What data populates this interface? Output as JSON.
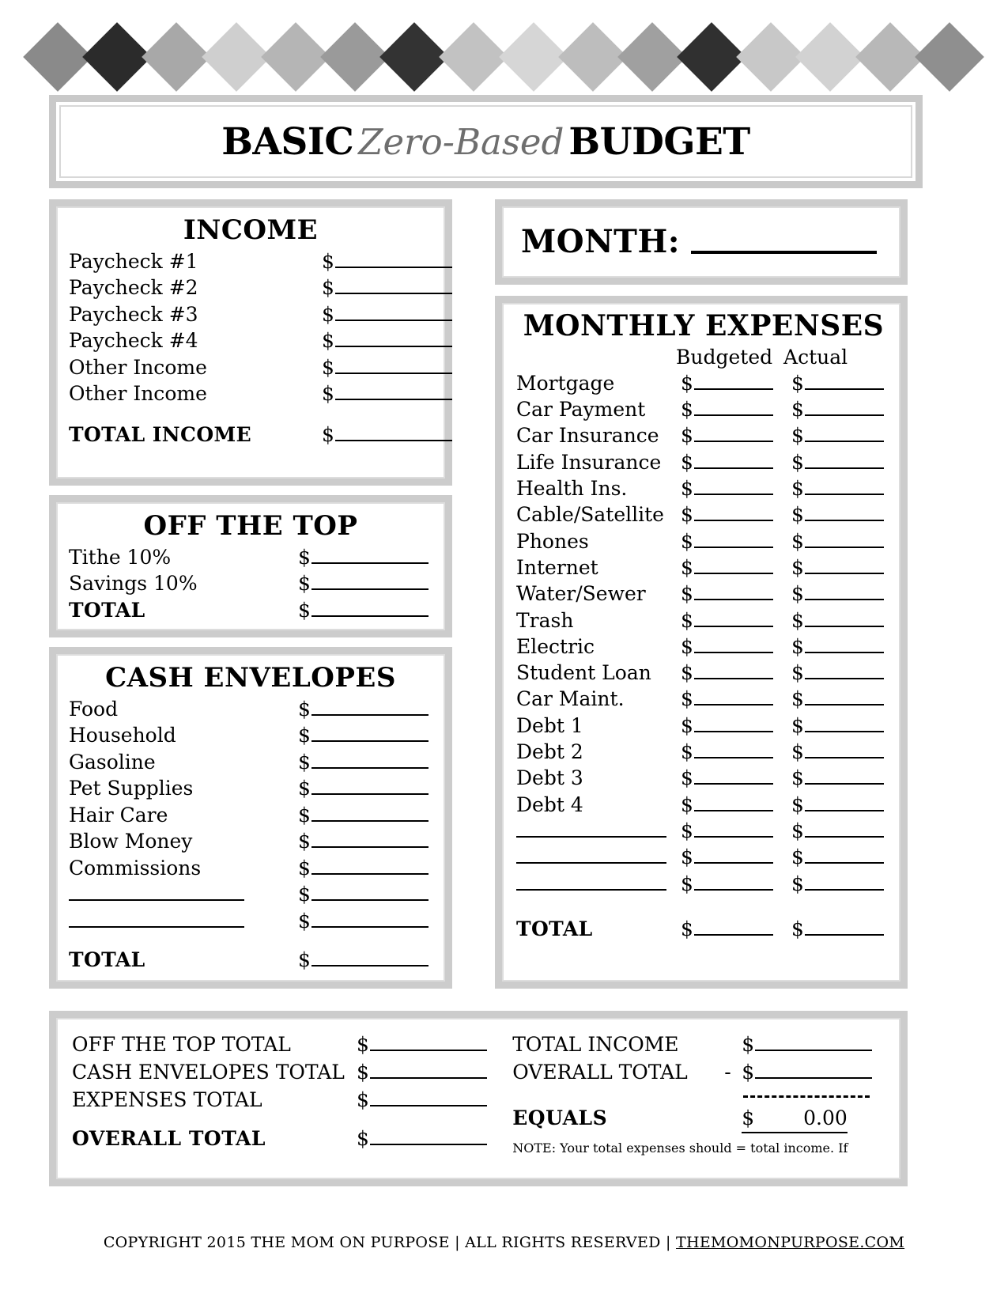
{
  "banner": {
    "diamond_colors": [
      "#8a8a8a",
      "#2b2b2b",
      "#a8a8a8",
      "#cfcfcf",
      "#b5b5b5",
      "#9a9a9a",
      "#333333",
      "#c2c2c2",
      "#d6d6d6",
      "#bdbdbd",
      "#a0a0a0",
      "#303030",
      "#c8c8c8",
      "#d2d2d2",
      "#b8b8b8",
      "#8f8f8f"
    ]
  },
  "title": {
    "part1": "BASIC",
    "part2": "Zero-Based",
    "part3": "BUDGET"
  },
  "income": {
    "heading": "INCOME",
    "rows": [
      {
        "label": "Paycheck #1",
        "dollar": "$"
      },
      {
        "label": "Paycheck #2",
        "dollar": "$"
      },
      {
        "label": "Paycheck #3",
        "dollar": "$"
      },
      {
        "label": "Paycheck #4",
        "dollar": "$"
      },
      {
        "label": "Other Income",
        "dollar": "$"
      },
      {
        "label": "Other Income",
        "dollar": "$"
      }
    ],
    "total_label": "TOTAL INCOME",
    "total_dollar": "$"
  },
  "off_the_top": {
    "heading": "OFF THE TOP",
    "rows": [
      {
        "label": "Tithe 10%",
        "dollar": "$"
      },
      {
        "label": "Savings 10%",
        "dollar": "$"
      }
    ],
    "total_label": "TOTAL",
    "total_dollar": "$"
  },
  "cash_envelopes": {
    "heading": "CASH ENVELOPES",
    "rows": [
      {
        "label": "Food",
        "dollar": "$"
      },
      {
        "label": "Household",
        "dollar": "$"
      },
      {
        "label": "Gasoline",
        "dollar": "$"
      },
      {
        "label": "Pet Supplies",
        "dollar": "$"
      },
      {
        "label": "Hair Care",
        "dollar": "$"
      },
      {
        "label": "Blow Money",
        "dollar": "$"
      },
      {
        "label": "Commissions",
        "dollar": "$"
      }
    ],
    "blank_rows": [
      {
        "label": "",
        "dollar": "$"
      },
      {
        "label": "",
        "dollar": "$"
      }
    ],
    "total_label": "TOTAL",
    "total_dollar": "$"
  },
  "month": {
    "label": "MONTH:",
    "value": ""
  },
  "expenses": {
    "heading": "MONTHLY EXPENSES",
    "col_budgeted": "Budgeted",
    "col_actual": "Actual",
    "rows": [
      {
        "label": "Mortgage",
        "budgeted": "$",
        "actual": "$"
      },
      {
        "label": "Car Payment",
        "budgeted": "$",
        "actual": "$"
      },
      {
        "label": "Car Insurance",
        "budgeted": "$",
        "actual": "$"
      },
      {
        "label": "Life Insurance",
        "budgeted": "$",
        "actual": "$"
      },
      {
        "label": "Health Ins.",
        "budgeted": "$",
        "actual": "$"
      },
      {
        "label": "Cable/Satellite",
        "budgeted": "$",
        "actual": "$"
      },
      {
        "label": "Phones",
        "budgeted": "$",
        "actual": "$"
      },
      {
        "label": "Internet",
        "budgeted": "$",
        "actual": "$"
      },
      {
        "label": "Water/Sewer",
        "budgeted": "$",
        "actual": "$"
      },
      {
        "label": "Trash",
        "budgeted": "$",
        "actual": "$"
      },
      {
        "label": "Electric",
        "budgeted": "$",
        "actual": "$"
      },
      {
        "label": "Student Loan",
        "budgeted": "$",
        "actual": "$"
      },
      {
        "label": "Car Maint.",
        "budgeted": "$",
        "actual": "$"
      },
      {
        "label": "Debt 1",
        "budgeted": "$",
        "actual": "$"
      },
      {
        "label": "Debt 2",
        "budgeted": "$",
        "actual": "$"
      },
      {
        "label": "Debt 3",
        "budgeted": "$",
        "actual": "$"
      },
      {
        "label": "Debt 4",
        "budgeted": "$",
        "actual": "$"
      }
    ],
    "blank_rows": [
      {
        "label": "",
        "budgeted": "$",
        "actual": "$"
      },
      {
        "label": "",
        "budgeted": "$",
        "actual": "$"
      },
      {
        "label": "",
        "budgeted": "$",
        "actual": "$"
      }
    ],
    "total_label": "TOTAL",
    "total_budgeted": "$",
    "total_actual": "$"
  },
  "summary": {
    "left_rows": [
      {
        "label": "OFF THE TOP TOTAL",
        "dollar": "$"
      },
      {
        "label": "CASH ENVELOPES TOTAL",
        "dollar": "$"
      },
      {
        "label": "EXPENSES TOTAL",
        "dollar": "$"
      }
    ],
    "left_total_label": "OVERALL TOTAL",
    "left_total_dollar": "$",
    "right_rows": [
      {
        "label": "TOTAL INCOME",
        "operator": "",
        "dollar": "$"
      },
      {
        "label": "OVERALL TOTAL",
        "operator": "-",
        "dollar": "$"
      }
    ],
    "equals_label": "EQUALS",
    "equals_dollar": "$",
    "equals_value": "0.00",
    "note": "NOTE: Your total expenses should = total income. If"
  },
  "footer": {
    "text": "COPYRIGHT 2015 THE MOM ON PURPOSE | ALL RIGHTS RESERVED | ",
    "site": "THEMOMONPURPOSE.COM"
  }
}
